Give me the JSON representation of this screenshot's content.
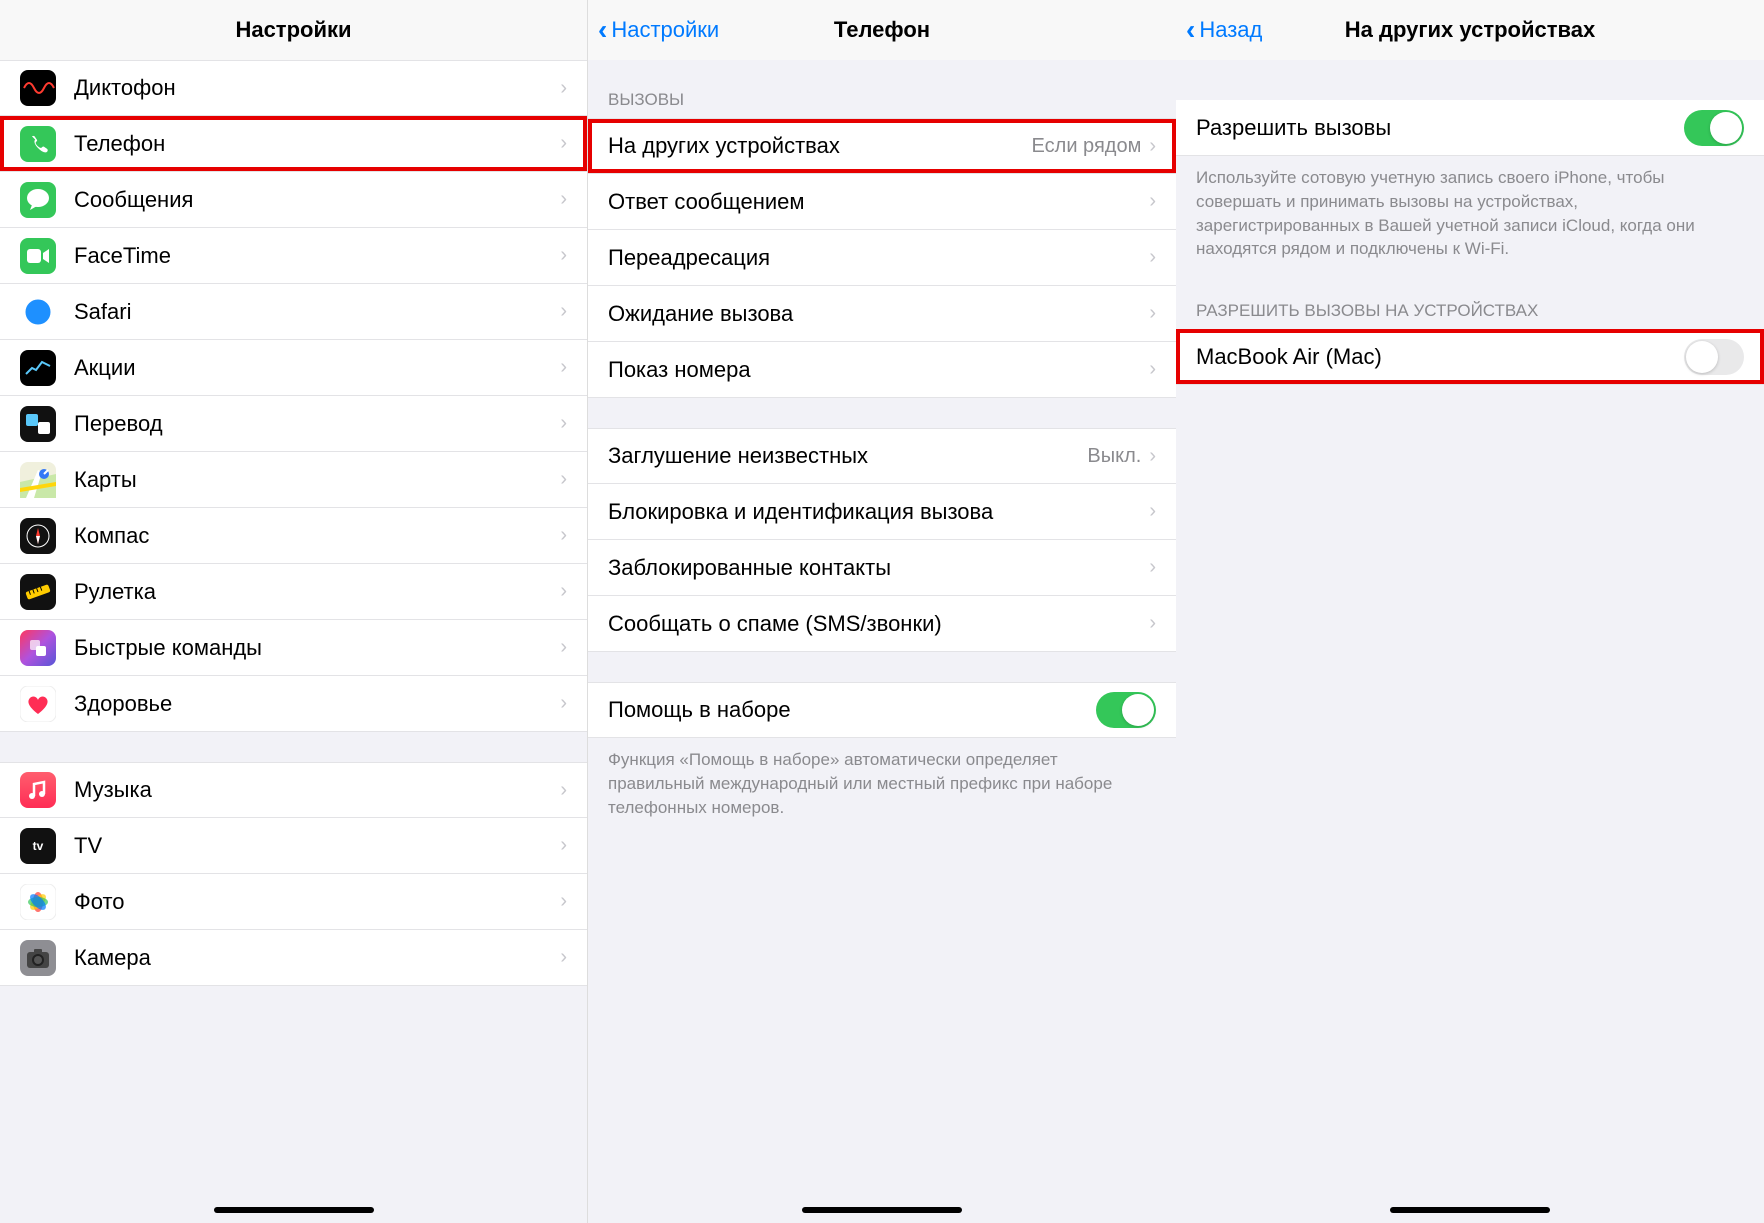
{
  "screen1": {
    "title": "Настройки",
    "items": [
      {
        "label": "Диктофон",
        "icon": "voice-memos",
        "bg": "#000"
      },
      {
        "label": "Телефон",
        "icon": "phone",
        "bg": "#34c759",
        "highlight": true
      },
      {
        "label": "Сообщения",
        "icon": "messages",
        "bg": "#34c759"
      },
      {
        "label": "FaceTime",
        "icon": "facetime",
        "bg": "#34c759"
      },
      {
        "label": "Safari",
        "icon": "safari",
        "bg": "#007aff"
      },
      {
        "label": "Акции",
        "icon": "stocks",
        "bg": "#000"
      },
      {
        "label": "Перевод",
        "icon": "translate",
        "bg": "#111"
      },
      {
        "label": "Карты",
        "icon": "maps",
        "bg": "#fff"
      },
      {
        "label": "Компас",
        "icon": "compass",
        "bg": "#111"
      },
      {
        "label": "Рулетка",
        "icon": "measure",
        "bg": "#111"
      },
      {
        "label": "Быстрые команды",
        "icon": "shortcuts",
        "bg": "#3a4db8"
      },
      {
        "label": "Здоровье",
        "icon": "health",
        "bg": "#fff"
      }
    ],
    "items2": [
      {
        "label": "Музыка",
        "icon": "music",
        "bg": "#ff2d55"
      },
      {
        "label": "TV",
        "icon": "tv",
        "bg": "#111"
      },
      {
        "label": "Фото",
        "icon": "photos",
        "bg": "#fff"
      },
      {
        "label": "Камера",
        "icon": "camera",
        "bg": "#8e8e93"
      }
    ]
  },
  "screen2": {
    "back": "Настройки",
    "title": "Телефон",
    "section1_header": "ВЫЗОВЫ",
    "group1": [
      {
        "label": "На других устройствах",
        "value": "Если рядом",
        "highlight": true
      },
      {
        "label": "Ответ сообщением"
      },
      {
        "label": "Переадресация"
      },
      {
        "label": "Ожидание вызова"
      },
      {
        "label": "Показ номера"
      }
    ],
    "group2": [
      {
        "label": "Заглушение неизвестных",
        "value": "Выкл."
      },
      {
        "label": "Блокировка и идентификация вызова"
      },
      {
        "label": "Заблокированные контакты"
      },
      {
        "label": "Сообщать о спаме (SMS/звонки)"
      }
    ],
    "group3": [
      {
        "label": "Помощь в наборе"
      }
    ],
    "footer": "Функция «Помощь в наборе» автоматически определяет правильный международный или местный префикс при наборе телефонных номеров."
  },
  "screen3": {
    "back": "Назад",
    "title": "На других устройствах",
    "allow_label": "Разрешить вызовы",
    "allow_footer": "Используйте сотовую учетную запись своего iPhone, чтобы совершать и принимать вызовы на устройствах, зарегистрированных в Вашей учетной записи iCloud, когда они находятся рядом и подключены к Wi-Fi.",
    "devices_header": "РАЗРЕШИТЬ ВЫЗОВЫ НА УСТРОЙСТВАХ",
    "device_label": "MacBook Air (Mac)"
  }
}
